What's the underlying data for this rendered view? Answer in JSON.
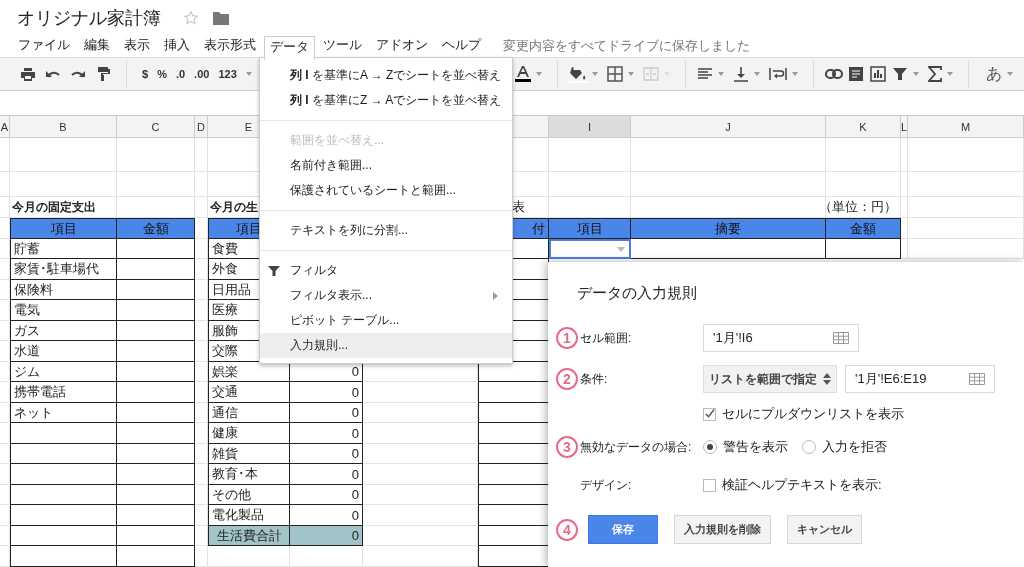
{
  "document": {
    "title": "オリジナル家計簿",
    "starred": false
  },
  "menubar": {
    "items": [
      {
        "label": "ファイル",
        "selected": false
      },
      {
        "label": "編集",
        "selected": false
      },
      {
        "label": "表示",
        "selected": false
      },
      {
        "label": "挿入",
        "selected": false
      },
      {
        "label": "表示形式",
        "selected": false
      },
      {
        "label": "データ",
        "selected": true
      },
      {
        "label": "ツール",
        "selected": false
      },
      {
        "label": "アドオン",
        "selected": false
      },
      {
        "label": "ヘルプ",
        "selected": false
      }
    ],
    "save_status": "変更内容をすべてドライブに保存しました"
  },
  "toolbar": {
    "currency": "$",
    "percent": "%",
    "decrease_decimals": ".0",
    "increase_decimals": ".00",
    "more_formats": "123",
    "input_tools": "あ"
  },
  "sheet": {
    "columns": [
      {
        "label": "A",
        "selected": false
      },
      {
        "label": "B",
        "selected": false
      },
      {
        "label": "C",
        "selected": false
      },
      {
        "label": "D",
        "selected": false
      },
      {
        "label": "E",
        "selected": false
      },
      {
        "label": "I",
        "selected": true
      },
      {
        "label": "J",
        "selected": false
      },
      {
        "label": "K",
        "selected": false
      },
      {
        "label": "L",
        "selected": false
      },
      {
        "label": "M",
        "selected": false
      }
    ],
    "fixed_expenses": {
      "title": "今月の固定支出",
      "headers": [
        "項目",
        "金額"
      ],
      "items": [
        "貯蓄",
        "家賃･駐車場代",
        "保険料",
        "電気",
        "ガス",
        "水道",
        "ジム",
        "携帯電話",
        "ネット"
      ]
    },
    "living_expenses": {
      "title": "今月の生",
      "header": "項目",
      "rows": [
        {
          "item": "食費"
        },
        {
          "item": "外食"
        },
        {
          "item": "日用品"
        },
        {
          "item": "医療"
        },
        {
          "item": "服飾"
        },
        {
          "item": "交際"
        },
        {
          "item": "娯楽",
          "amount": "0"
        },
        {
          "item": "交通",
          "amount": "0"
        },
        {
          "item": "通信",
          "amount": "0"
        },
        {
          "item": "健康",
          "amount": "0"
        },
        {
          "item": "雑貨",
          "amount": "0"
        },
        {
          "item": "教育･本",
          "amount": "0"
        },
        {
          "item": "その他",
          "amount": "0"
        },
        {
          "item": "電化製品",
          "amount": "0"
        }
      ],
      "total": {
        "label": "生活費合計",
        "amount": "0"
      }
    },
    "ledger": {
      "title": "表",
      "unit": "（単位：円）",
      "headers": [
        "付",
        "項目",
        "摘要",
        "金額"
      ],
      "first_row": [
        {
          "selected": false
        },
        {
          "selected": true
        },
        {
          "selected": false
        },
        {
          "selected": false
        }
      ]
    }
  },
  "data_menu": {
    "items": [
      {
        "kind": "item",
        "label": "**列 I** を基準にA → Zでシートを並べ替え",
        "disabled": false,
        "selected": false,
        "submenu": false
      },
      {
        "kind": "item",
        "label": "**列 I** を基準にZ → Aでシートを並べ替え",
        "disabled": false,
        "selected": false,
        "submenu": false
      },
      {
        "kind": "separator"
      },
      {
        "kind": "item",
        "label": "範囲を並べ替え...",
        "disabled": true,
        "selected": false,
        "submenu": false
      },
      {
        "kind": "item",
        "label": "名前付き範囲...",
        "disabled": false,
        "selected": false,
        "submenu": false
      },
      {
        "kind": "item",
        "label": "保護されているシートと範囲...",
        "disabled": false,
        "selected": false,
        "submenu": false
      },
      {
        "kind": "separator"
      },
      {
        "kind": "item",
        "label": "テキストを列に分割...",
        "disabled": false,
        "selected": false,
        "submenu": false
      },
      {
        "kind": "separator"
      },
      {
        "kind": "icon_item",
        "label": "フィルタ",
        "disabled": false,
        "selected": false,
        "submenu": false
      },
      {
        "kind": "item",
        "label": "フィルタ表示...",
        "disabled": false,
        "selected": false,
        "submenu": true
      },
      {
        "kind": "item",
        "label": "ピボット テーブル...",
        "disabled": false,
        "selected": false,
        "submenu": false
      },
      {
        "kind": "item",
        "label": "入力規則...",
        "disabled": false,
        "selected": true,
        "submenu": false
      }
    ]
  },
  "validation_dialog": {
    "title": "データの入力規則",
    "cell_range": {
      "step": "1",
      "label": "セル範囲:",
      "value": "'1月'!I6"
    },
    "criteria": {
      "step": "2",
      "label": "条件:",
      "select": "リストを範囲で指定",
      "value": "'1月'!E6:E19",
      "show_dropdown": {
        "label": "セルにプルダウンリストを表示",
        "checked": true
      }
    },
    "invalid_data": {
      "step": "3",
      "label": "無効なデータの場合:",
      "options": [
        {
          "label": "警告を表示",
          "selected": true
        },
        {
          "label": "入力を拒否",
          "selected": false
        }
      ]
    },
    "design": {
      "label": "デザイン:",
      "help_text": {
        "label": "検証ヘルプテキストを表示:",
        "checked": false
      }
    },
    "buttons_step": "4",
    "buttons": [
      {
        "kind": "primary",
        "label": "保存"
      },
      {
        "kind": "secondary",
        "label": "入力規則を削除"
      },
      {
        "kind": "secondary",
        "label": "キャンセル"
      }
    ]
  }
}
